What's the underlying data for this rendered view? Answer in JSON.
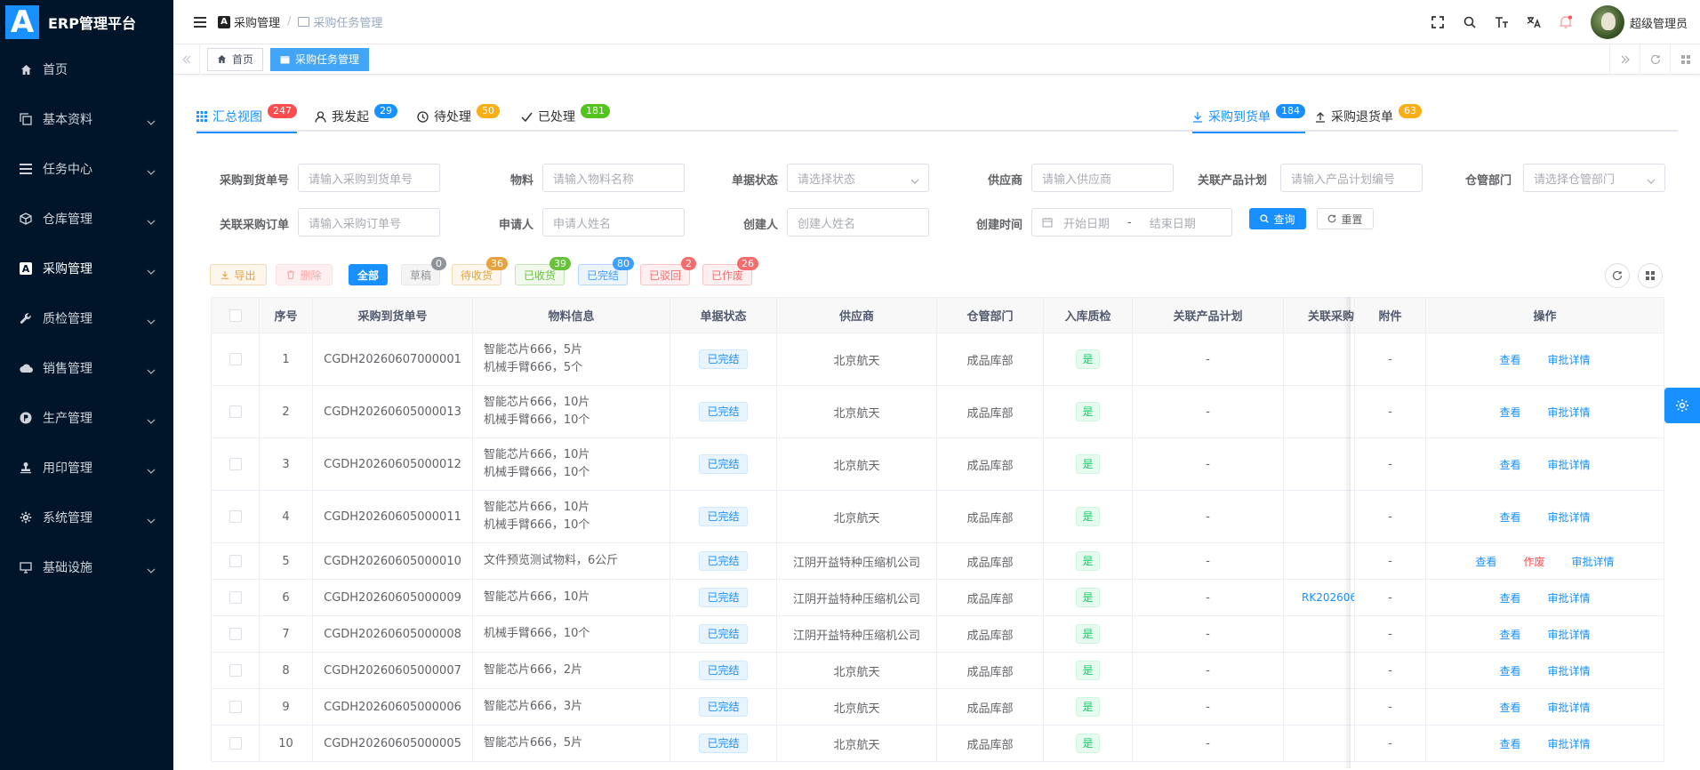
{
  "app": {
    "logo_letter": "A",
    "title": "ERP管理平台"
  },
  "sidebar": {
    "items": [
      {
        "label": "首页",
        "icon": "home-icon",
        "has_arrow": false
      },
      {
        "label": "基本资料",
        "icon": "copy-icon",
        "has_arrow": true
      },
      {
        "label": "任务中心",
        "icon": "task-list-icon",
        "has_arrow": true
      },
      {
        "label": "仓库管理",
        "icon": "cube-icon",
        "has_arrow": true
      },
      {
        "label": "采购管理",
        "icon": "purchase-a-icon",
        "has_arrow": true
      },
      {
        "label": "质检管理",
        "icon": "wrench-icon",
        "has_arrow": true
      },
      {
        "label": "销售管理",
        "icon": "cloud-chart-icon",
        "has_arrow": true
      },
      {
        "label": "生产管理",
        "icon": "p-circle-icon",
        "has_arrow": true
      },
      {
        "label": "用印管理",
        "icon": "stamp-icon",
        "has_arrow": true
      },
      {
        "label": "系统管理",
        "icon": "gear-icon",
        "has_arrow": true
      },
      {
        "label": "基础设施",
        "icon": "monitor-icon",
        "has_arrow": true
      }
    ]
  },
  "breadcrumb": {
    "first": "采购管理",
    "separator": "/",
    "second": "采购任务管理"
  },
  "user": {
    "name": "超级管理员"
  },
  "tags": {
    "home": "首页",
    "current": "采购任务管理"
  },
  "view_tabs": [
    {
      "label": "汇总视图",
      "count": "247",
      "color": "#ff4d4f",
      "icon": "grid-icon",
      "active": true
    },
    {
      "label": "我发起",
      "count": "29",
      "color": "#1890ff",
      "icon": "user-icon",
      "active": false
    },
    {
      "label": "待处理",
      "count": "50",
      "color": "#faad14",
      "icon": "clock-icon",
      "active": false
    },
    {
      "label": "已处理",
      "count": "181",
      "color": "#52c41a",
      "icon": "check-icon",
      "active": false
    },
    {
      "label": "采购到货单",
      "count": "184",
      "color": "#1890ff",
      "icon": "download-icon",
      "active": true
    },
    {
      "label": "采购退货单",
      "count": "63",
      "color": "#faad14",
      "icon": "upload-icon",
      "active": false
    }
  ],
  "filters": {
    "row1": [
      {
        "label": "采购到货单号",
        "placeholder": "请输入采购到货单号"
      },
      {
        "label": "物料",
        "placeholder": "请输入物料名称"
      },
      {
        "label": "单据状态",
        "placeholder": "请选择状态"
      },
      {
        "label": "供应商",
        "placeholder": "请输入供应商"
      },
      {
        "label": "关联产品计划",
        "placeholder": "请输入产品计划编号"
      },
      {
        "label": "仓管部门",
        "placeholder": "请选择仓管部门"
      }
    ],
    "row2": [
      {
        "label": "关联采购订单",
        "placeholder": "请输入采购订单号"
      },
      {
        "label": "申请人",
        "placeholder": "申请人姓名"
      },
      {
        "label": "创建人",
        "placeholder": "创建人姓名"
      }
    ],
    "date": {
      "label": "创建时间",
      "start": "开始日期",
      "dash": "-",
      "end": "结束日期"
    },
    "search_btn": "查询",
    "reset_btn": "重置"
  },
  "actions": {
    "export": "导出",
    "delete": "删除"
  },
  "status_chips": [
    {
      "label": "全部",
      "count": ""
    },
    {
      "label": "草稿",
      "count": "0"
    },
    {
      "label": "待收货",
      "count": "36"
    },
    {
      "label": "已收货",
      "count": "39"
    },
    {
      "label": "已完结",
      "count": "80"
    },
    {
      "label": "已驳回",
      "count": "2"
    },
    {
      "label": "已作废",
      "count": "26"
    }
  ],
  "table": {
    "headers": {
      "index": "序号",
      "no": "采购到货单号",
      "material": "物料信息",
      "status": "单据状态",
      "supplier": "供应商",
      "dept": "仓管部门",
      "qc": "入库质检",
      "plan": "关联产品计划",
      "order": "关联采购",
      "attach": "附件",
      "ops": "操作"
    },
    "rows": [
      {
        "index": "1",
        "no": "CGDH20260607000001",
        "material": [
          "智能芯片666，5片",
          "机械手臂666，5个"
        ],
        "status": "已完结",
        "supplier": "北京航天",
        "dept": "成品库部",
        "qc": "是",
        "plan": "-",
        "order": "",
        "attach": "-",
        "ops": [
          "查看",
          "审批详情"
        ]
      },
      {
        "index": "2",
        "no": "CGDH20260605000013",
        "material": [
          "智能芯片666，10片",
          "机械手臂666，10个"
        ],
        "status": "已完结",
        "supplier": "北京航天",
        "dept": "成品库部",
        "qc": "是",
        "plan": "-",
        "order": "",
        "attach": "-",
        "ops": [
          "查看",
          "审批详情"
        ]
      },
      {
        "index": "3",
        "no": "CGDH20260605000012",
        "material": [
          "智能芯片666，10片",
          "机械手臂666，10个"
        ],
        "status": "已完结",
        "supplier": "北京航天",
        "dept": "成品库部",
        "qc": "是",
        "plan": "-",
        "order": "",
        "attach": "-",
        "ops": [
          "查看",
          "审批详情"
        ]
      },
      {
        "index": "4",
        "no": "CGDH20260605000011",
        "material": [
          "智能芯片666，10片",
          "机械手臂666，10个"
        ],
        "status": "已完结",
        "supplier": "北京航天",
        "dept": "成品库部",
        "qc": "是",
        "plan": "-",
        "order": "",
        "attach": "-",
        "ops": [
          "查看",
          "审批详情"
        ]
      },
      {
        "index": "5",
        "no": "CGDH20260605000010",
        "material": [
          "文件预览测试物料，6公斤"
        ],
        "status": "已完结",
        "supplier": "江阴开益特种压缩机公司",
        "dept": "成品库部",
        "qc": "是",
        "plan": "-",
        "order": "",
        "attach": "-",
        "ops": [
          "查看",
          "作废",
          "审批详情"
        ]
      },
      {
        "index": "6",
        "no": "CGDH20260605000009",
        "material": [
          "智能芯片666，10片"
        ],
        "status": "已完结",
        "supplier": "江阴开益特种压缩机公司",
        "dept": "成品库部",
        "qc": "是",
        "plan": "-",
        "order": "RK202606",
        "attach": "-",
        "ops": [
          "查看",
          "审批详情"
        ]
      },
      {
        "index": "7",
        "no": "CGDH20260605000008",
        "material": [
          "机械手臂666，10个"
        ],
        "status": "已完结",
        "supplier": "江阴开益特种压缩机公司",
        "dept": "成品库部",
        "qc": "是",
        "plan": "-",
        "order": "",
        "attach": "-",
        "ops": [
          "查看",
          "审批详情"
        ]
      },
      {
        "index": "8",
        "no": "CGDH20260605000007",
        "material": [
          "智能芯片666，2片"
        ],
        "status": "已完结",
        "supplier": "北京航天",
        "dept": "成品库部",
        "qc": "是",
        "plan": "-",
        "order": "",
        "attach": "-",
        "ops": [
          "查看",
          "审批详情"
        ]
      },
      {
        "index": "9",
        "no": "CGDH20260605000006",
        "material": [
          "智能芯片666，3片"
        ],
        "status": "已完结",
        "supplier": "北京航天",
        "dept": "成品库部",
        "qc": "是",
        "plan": "-",
        "order": "",
        "attach": "-",
        "ops": [
          "查看",
          "审批详情"
        ]
      },
      {
        "index": "10",
        "no": "CGDH20260605000005",
        "material": [
          "智能芯片666，5片"
        ],
        "status": "已完结",
        "supplier": "北京航天",
        "dept": "成品库部",
        "qc": "是",
        "plan": "-",
        "order": "",
        "attach": "-",
        "ops": [
          "查看",
          "审批详情"
        ]
      }
    ]
  }
}
